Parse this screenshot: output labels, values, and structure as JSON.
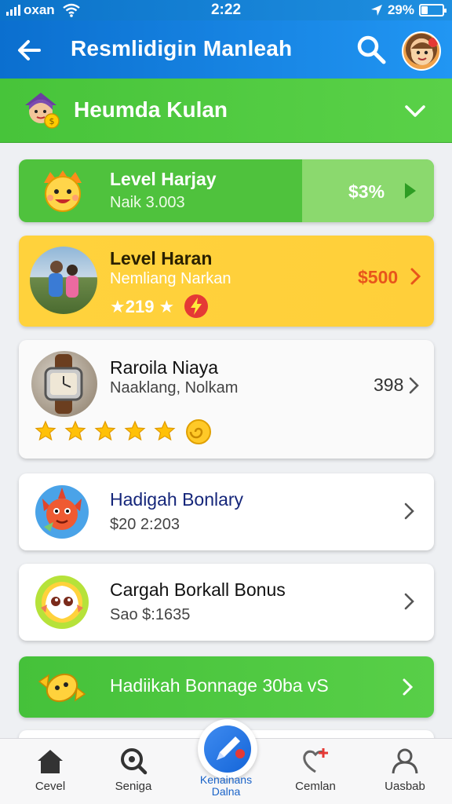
{
  "status_bar": {
    "carrier": "oxan",
    "time": "2:22",
    "battery": "29%",
    "battery_level": 0.29
  },
  "app_bar": {
    "title": "Resmlidigin Manleah",
    "back_icon": "arrow-left-icon",
    "search_icon": "search-icon",
    "avatar": "cartoon-avatar"
  },
  "section": {
    "title": "Heumda Kulan",
    "chevron": "chevron-down-icon"
  },
  "cards": [
    {
      "title": "Level Harjay",
      "subtitle": "Naik 3.003",
      "value": "$3%",
      "icon": "cartoon-face-icon",
      "accent": "#4fc23d"
    },
    {
      "title": "Level Haran",
      "subtitle": "Nemliang Narkan",
      "value": "$500",
      "rating": "★219 ★",
      "icon": "couple-photo",
      "accent": "#ffd23c",
      "value_color": "#e8551b"
    },
    {
      "title": "Raroila Niaya",
      "subtitle": "Naaklang, Nolkam",
      "value": "398",
      "stars": 5,
      "icon": "watch-photo"
    },
    {
      "title": "Hadigah Bonlary",
      "subtitle": "$20 2:203",
      "icon": "fish-icon",
      "title_color": "#15267a"
    },
    {
      "title": "Cargah Borkall Bonus",
      "subtitle": "Sao $:1635",
      "icon": "ghost-icon"
    },
    {
      "title": "Hadiikah Bonnage 30ba vS",
      "icon": "candy-icon",
      "accent": "#45c13a"
    }
  ],
  "bottom_nav": [
    {
      "label": "Cevel",
      "icon": "home-icon"
    },
    {
      "label": "Seniga",
      "icon": "search-icon"
    },
    {
      "label": "Kenainans Dalna",
      "icon": "pen-icon",
      "active": true
    },
    {
      "label": "Cemlan",
      "icon": "heart-plus-icon"
    },
    {
      "label": "Uasbab",
      "icon": "user-icon"
    }
  ]
}
